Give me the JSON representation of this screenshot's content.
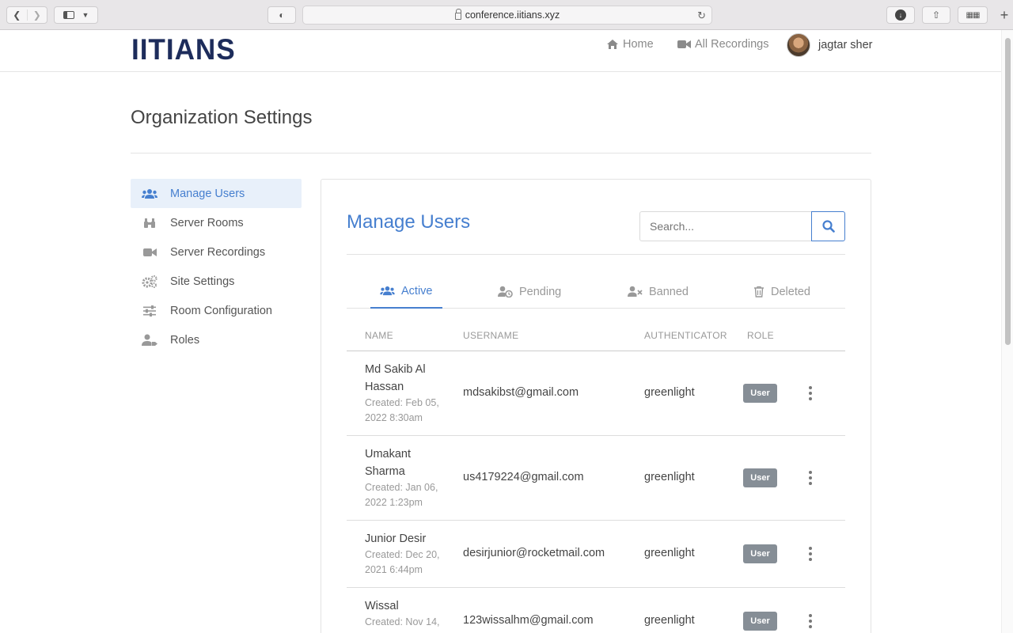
{
  "browser": {
    "url": "conference.iitians.xyz"
  },
  "nav": {
    "logo": "IITIANS",
    "home": "Home",
    "recordings": "All Recordings",
    "user": "jagtar sher"
  },
  "page": {
    "title": "Organization Settings"
  },
  "sidebar": {
    "items": [
      {
        "label": "Manage Users",
        "icon": "users-icon"
      },
      {
        "label": "Server Rooms",
        "icon": "binoculars-icon"
      },
      {
        "label": "Server Recordings",
        "icon": "video-icon"
      },
      {
        "label": "Site Settings",
        "icon": "cogs-icon"
      },
      {
        "label": "Room Configuration",
        "icon": "sliders-icon"
      },
      {
        "label": "Roles",
        "icon": "user-tag-icon"
      }
    ]
  },
  "main": {
    "title": "Manage Users",
    "search_placeholder": "Search...",
    "tabs": [
      {
        "label": "Active"
      },
      {
        "label": "Pending"
      },
      {
        "label": "Banned"
      },
      {
        "label": "Deleted"
      }
    ],
    "columns": {
      "name": "NAME",
      "username": "USERNAME",
      "authenticator": "AUTHENTICATOR",
      "role": "ROLE"
    },
    "rows": [
      {
        "name": "Md Sakib Al Hassan",
        "created": "Created: Feb 05, 2022 8:30am",
        "username": "mdsakibst@gmail.com",
        "auth": "greenlight",
        "role": "User"
      },
      {
        "name": "Umakant Sharma",
        "created": "Created: Jan 06, 2022 1:23pm",
        "username": "us4179224@gmail.com",
        "auth": "greenlight",
        "role": "User"
      },
      {
        "name": "Junior Desir",
        "created": "Created: Dec 20, 2021 6:44pm",
        "username": "desirjunior@rocketmail.com",
        "auth": "greenlight",
        "role": "User"
      },
      {
        "name": "Wissal",
        "created": "Created: Nov 14,",
        "username": "123wissalhm@gmail.com",
        "auth": "greenlight",
        "role": "User"
      }
    ]
  }
}
